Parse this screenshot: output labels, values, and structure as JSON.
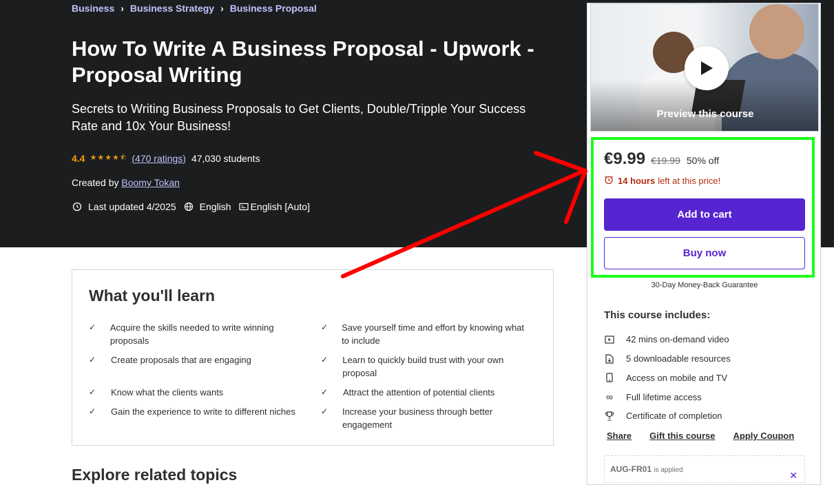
{
  "breadcrumb": [
    "Business",
    "Business Strategy",
    "Business Proposal"
  ],
  "course": {
    "title": "How To Write A Business Proposal - Upwork - Proposal Writing",
    "subtitle": "Secrets to Writing Business Proposals to Get Clients, Double/Tripple Your Success Rate and 10x Your Business!",
    "rating": "4.4",
    "ratings_count": "(470 ratings)",
    "students": "47,030 students",
    "created_by_label": "Created by",
    "author": "Boomy Tokan",
    "last_updated": "Last updated 4/2025",
    "language": "English",
    "captions": "English [Auto]"
  },
  "sidebar": {
    "preview_label": "Preview this course",
    "price": "€9.99",
    "original_price": "€19.99",
    "discount": "50% off",
    "timer_bold": "14 hours",
    "timer_rest": "left at this price!",
    "add_to_cart": "Add to cart",
    "buy_now": "Buy now",
    "guarantee": "30-Day Money-Back Guarantee",
    "includes_title": "This course includes:",
    "includes": [
      {
        "icon": "video-icon",
        "label": "42 mins on-demand video"
      },
      {
        "icon": "file-download-icon",
        "label": "5 downloadable resources"
      },
      {
        "icon": "mobile-icon",
        "label": "Access on mobile and TV"
      },
      {
        "icon": "infinity-icon",
        "label": "Full lifetime access"
      },
      {
        "icon": "trophy-icon",
        "label": "Certificate of completion"
      }
    ],
    "links": [
      "Share",
      "Gift this course",
      "Apply Coupon"
    ],
    "coupon_code": "AUG-FR01",
    "coupon_status": "is applied"
  },
  "learn": {
    "title": "What you'll learn",
    "left": [
      "Acquire the skills needed to write winning proposals",
      "Create proposals that are engaging",
      "Know what the clients wants",
      "Gain the experience to write to different niches"
    ],
    "right": [
      "Save yourself time and effort by knowing what to include",
      "Learn to quickly build trust with your own proposal",
      "Attract the attention of potential clients",
      "Increase your business through better engagement"
    ]
  },
  "featured_title": "Explore related topics",
  "colors": {
    "hero_bg": "#1c1d1f",
    "accent": "#5624d0",
    "link": "#c0c4fc",
    "rating": "#f69c08",
    "highlight": "#1aff1a",
    "annotation_arrow": "#ff0000"
  }
}
